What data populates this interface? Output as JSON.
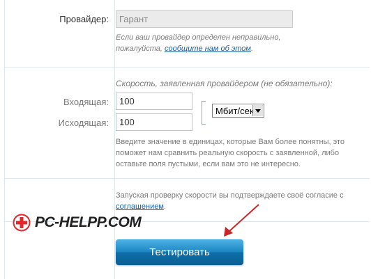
{
  "provider": {
    "label": "Провайдер:",
    "value": "Гарант",
    "hint_text": "Если ваш провайдер определен неправильно, пожалуйста,",
    "hint_link": "сообщите нам об этом",
    "hint_end": "."
  },
  "speed": {
    "caption": "Скорость, заявленная провайдером (не обязательно):",
    "incoming_label": "Входящая:",
    "incoming_value": "100",
    "outgoing_label": "Исходящая:",
    "outgoing_value": "100",
    "unit_selected": "Мбит/сек",
    "hint": "Введите значение в единицах, которые Вам более понятны, это поможет нам сравнить реальную скорость с заявленной, либо оставьте поля пустыми, если вам это не интересно."
  },
  "consent": {
    "text": "Запуская проверку скорости вы подтверждаете своё согласие с",
    "link": "соглашением",
    "end": "."
  },
  "submit_label": "Тестировать",
  "watermark": {
    "text": "PC-HELPP.COM",
    "accent_color": "#e3262b"
  },
  "colors": {
    "button": "#1c87c4",
    "link": "#1a5fa0",
    "annotation_arrow": "#c62828"
  }
}
